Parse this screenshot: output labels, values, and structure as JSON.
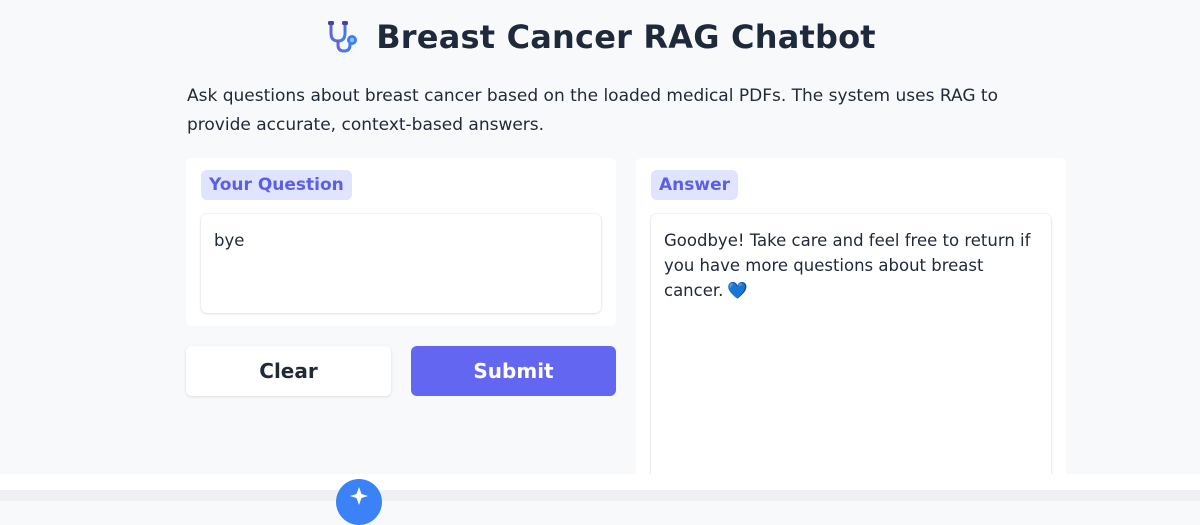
{
  "header": {
    "title": "Breast Cancer RAG Chatbot",
    "icon": "stethoscope-icon"
  },
  "description": "Ask questions about breast cancer based on the loaded medical PDFs. The system uses RAG to provide accurate, context-based answers.",
  "question": {
    "label": "Your Question",
    "value": "bye"
  },
  "answer": {
    "label": "Answer",
    "value": "Goodbye! Take care and feel free to return if you have more questions about breast cancer.",
    "emoji": "💙"
  },
  "buttons": {
    "clear_label": "Clear",
    "submit_label": "Submit"
  },
  "colors": {
    "accent": "#6366f1",
    "label_bg": "#e0e4ff",
    "label_text": "#5b5fe6",
    "page_bg": "#f8f9fb",
    "fab": "#3b82f6"
  }
}
